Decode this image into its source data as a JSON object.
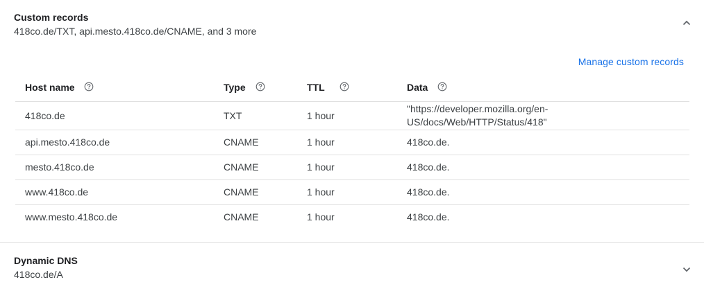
{
  "custom_records": {
    "title": "Custom records",
    "summary": "418co.de/TXT, api.mesto.418co.de/CNAME, and 3 more",
    "manage_link": "Manage custom records",
    "columns": {
      "host": "Host name",
      "type": "Type",
      "ttl": "TTL",
      "data": "Data"
    },
    "rows": [
      {
        "host": "418co.de",
        "type": "TXT",
        "ttl": "1 hour",
        "data": "\"https://developer.mozilla.org/en-US/docs/Web/HTTP/Status/418\""
      },
      {
        "host": "api.mesto.418co.de",
        "type": "CNAME",
        "ttl": "1 hour",
        "data": "418co.de."
      },
      {
        "host": "mesto.418co.de",
        "type": "CNAME",
        "ttl": "1 hour",
        "data": "418co.de."
      },
      {
        "host": "www.418co.de",
        "type": "CNAME",
        "ttl": "1 hour",
        "data": "418co.de."
      },
      {
        "host": "www.mesto.418co.de",
        "type": "CNAME",
        "ttl": "1 hour",
        "data": "418co.de."
      }
    ]
  },
  "dynamic_dns": {
    "title": "Dynamic DNS",
    "summary": "418co.de/A"
  },
  "icons": {
    "collapse": "chevron-up-icon",
    "expand": "chevron-down-icon",
    "help": "help-circle-icon"
  },
  "colors": {
    "link": "#1a73e8",
    "divider": "#e0e0e0",
    "text": "#202124"
  }
}
